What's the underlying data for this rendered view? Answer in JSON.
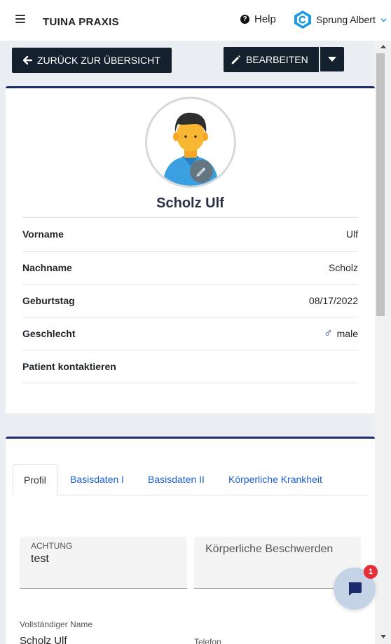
{
  "header": {
    "app_title": "TUINA PRAXIS",
    "help_label": "Help",
    "user_name": "Sprung Albert"
  },
  "toolbar": {
    "back_label": "ZURÜCK ZUR ÜBERSICHT",
    "edit_label": "BEARBEITEN"
  },
  "patient": {
    "name": "Scholz Ulf",
    "details": [
      {
        "label": "Vorname",
        "value": "Ulf"
      },
      {
        "label": "Nachname",
        "value": "Scholz"
      },
      {
        "label": "Geburtstag",
        "value": "08/17/2022"
      },
      {
        "label": "Geschlecht",
        "value": "male",
        "icon": "male-symbol-icon"
      },
      {
        "label": "Patient kontaktieren",
        "value": ""
      }
    ]
  },
  "tabs": [
    {
      "label": "Profil",
      "active": true
    },
    {
      "label": "Basisdaten I",
      "active": false
    },
    {
      "label": "Basisdaten II",
      "active": false
    },
    {
      "label": "Körperliche Krankheit",
      "active": false
    }
  ],
  "form": {
    "achtung_label": "ACHTUNG",
    "achtung_value": "test",
    "beschwerden_placeholder": "Körperliche Beschwerden",
    "fullname_label": "Vollständiger Name",
    "fullname_value": "Scholz Ulf",
    "telefon_label": "Telefon"
  },
  "chat": {
    "badge_count": "1"
  },
  "colors": {
    "primary_dark": "#14202e",
    "card_accent": "#1b2a6b",
    "link_blue": "#1b5fd4",
    "badge_red": "#e3303a"
  }
}
